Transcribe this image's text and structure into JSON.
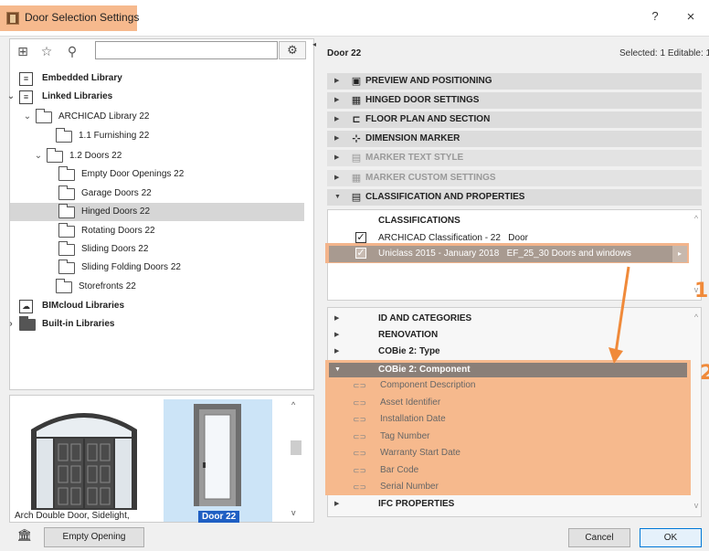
{
  "window": {
    "title": "Door Selection Settings",
    "help_label": "?",
    "close_label": "×"
  },
  "left_panel": {
    "search_placeholder": "",
    "tree": [
      {
        "label": "Embedded Library",
        "bold": true
      },
      {
        "label": "Linked Libraries",
        "bold": true
      },
      {
        "label": "ARCHICAD Library 22",
        "bold": false
      },
      {
        "label": "1.1 Furnishing 22",
        "bold": false
      },
      {
        "label": "1.2 Doors 22",
        "bold": false
      },
      {
        "label": "Empty Door Openings 22",
        "bold": false
      },
      {
        "label": "Garage Doors 22",
        "bold": false
      },
      {
        "label": "Hinged Doors 22",
        "bold": false,
        "selected": true
      },
      {
        "label": "Rotating Doors 22",
        "bold": false
      },
      {
        "label": "Sliding Doors 22",
        "bold": false
      },
      {
        "label": "Sliding Folding Doors 22",
        "bold": false
      },
      {
        "label": "Storefronts 22",
        "bold": false
      },
      {
        "label": "BIMcloud Libraries",
        "bold": true
      },
      {
        "label": "Built-in Libraries",
        "bold": true
      }
    ],
    "previews": [
      {
        "label": "Arch Double Door, Sidelight,"
      },
      {
        "label": "Door 22",
        "selected": true
      }
    ],
    "empty_opening_label": "Empty Opening"
  },
  "right_panel": {
    "element_title": "Door 22",
    "selected_info": "Selected: 1 Editable: 1",
    "sections": [
      {
        "label": "PREVIEW AND POSITIONING",
        "disabled": false,
        "expanded": false
      },
      {
        "label": "HINGED DOOR SETTINGS",
        "disabled": false,
        "expanded": false
      },
      {
        "label": "FLOOR PLAN AND SECTION",
        "disabled": false,
        "expanded": false
      },
      {
        "label": "DIMENSION MARKER",
        "disabled": false,
        "expanded": false
      },
      {
        "label": "MARKER TEXT STYLE",
        "disabled": true,
        "expanded": false
      },
      {
        "label": "MARKER CUSTOM SETTINGS",
        "disabled": true,
        "expanded": false
      },
      {
        "label": "CLASSIFICATION AND PROPERTIES",
        "disabled": false,
        "expanded": true
      }
    ],
    "classifications": {
      "header": "CLASSIFICATIONS",
      "rows": [
        {
          "system": "ARCHICAD Classification - 22",
          "value": "Door",
          "checked": true
        },
        {
          "system": "Uniclass 2015 - January 2018",
          "value": "EF_25_30 Doors and windows",
          "checked": true,
          "highlighted": true
        }
      ]
    },
    "properties": {
      "groups_before": [
        "ID AND CATEGORIES",
        "RENOVATION",
        "COBie 2: Type"
      ],
      "expanded_group": "COBie 2: Component",
      "fields": [
        "Component Description",
        "Asset Identifier",
        "Installation Date",
        "Tag Number",
        "Warranty Start Date",
        "Bar Code",
        "Serial Number"
      ],
      "groups_after": [
        "IFC PROPERTIES"
      ]
    },
    "cancel_label": "Cancel",
    "ok_label": "OK"
  },
  "annotations": {
    "marker_1": "1",
    "marker_2": "2",
    "highlight_color": "#f6b98d",
    "arrow_color": "#f08a3a"
  }
}
